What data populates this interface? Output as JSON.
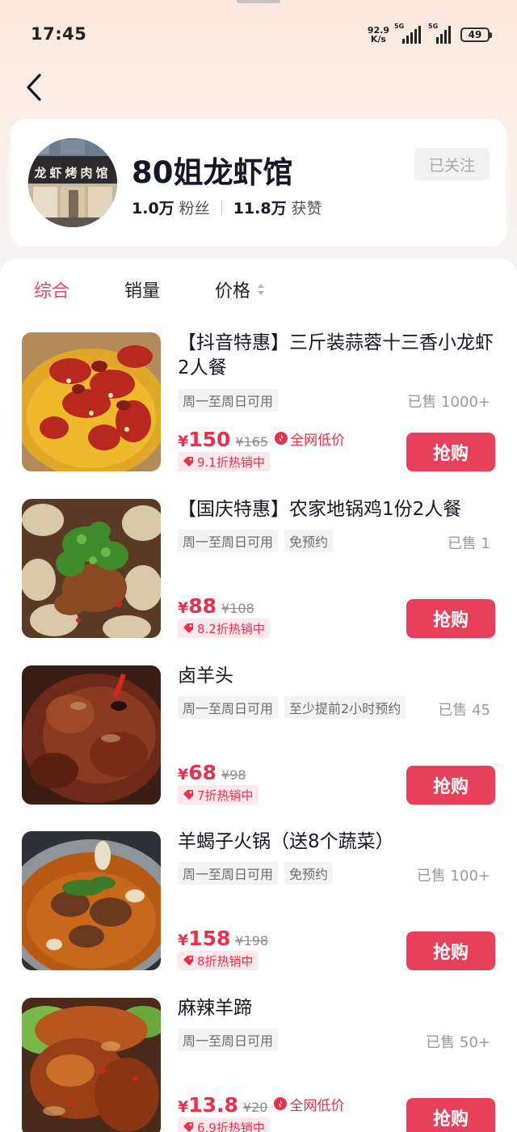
{
  "status_bar": {
    "time": "17:45",
    "speed_value": "92.9",
    "speed_unit": "K/s",
    "net1": "5G",
    "net2": "5G",
    "battery": "49"
  },
  "shop": {
    "name": "80姐龙虾馆",
    "fans_count": "1.0万",
    "fans_label": "粉丝",
    "likes_count": "11.8万",
    "likes_label": "获赞",
    "follow_label": "已关注",
    "avatar_sign": "龙虾烤肉馆"
  },
  "sort_tabs": {
    "comprehensive": "综合",
    "sales": "销量",
    "price": "价格"
  },
  "products": [
    {
      "title": "【抖音特惠】三斤装蒜蓉十三香小龙虾2人餐",
      "tags": [
        "周一至周日可用"
      ],
      "sold": "已售 1000+",
      "yen": "¥",
      "price": "150",
      "original": "¥165",
      "lowest": "全网低价",
      "discount": "9.1折热销中",
      "buy": "抢购"
    },
    {
      "title": "【国庆特惠】农家地锅鸡1份2人餐",
      "tags": [
        "周一至周日可用",
        "免预约"
      ],
      "sold": "已售 1",
      "yen": "¥",
      "price": "88",
      "original": "¥108",
      "discount": "8.2折热销中",
      "buy": "抢购"
    },
    {
      "title": "卤羊头",
      "tags": [
        "周一至周日可用",
        "至少提前2小时预约"
      ],
      "sold": "已售 45",
      "yen": "¥",
      "price": "68",
      "original": "¥98",
      "discount": "7折热销中",
      "buy": "抢购"
    },
    {
      "title": "羊蝎子火锅（送8个蔬菜）",
      "tags": [
        "周一至周日可用",
        "免预约"
      ],
      "sold": "已售 100+",
      "yen": "¥",
      "price": "158",
      "original": "¥198",
      "discount": "8折热销中",
      "buy": "抢购"
    },
    {
      "title": "麻辣羊蹄",
      "tags": [
        "周一至周日可用"
      ],
      "sold": "已售 50+",
      "yen": "¥",
      "price": "13.8",
      "original": "¥20",
      "lowest": "全网低价",
      "discount": "6.9折热销中",
      "buy": "抢购"
    }
  ],
  "colors": {
    "accent": "#e8304f",
    "buy_button": "#e8405a",
    "discount_bg": "#fde8ec",
    "active_tab": "#e8496a"
  }
}
